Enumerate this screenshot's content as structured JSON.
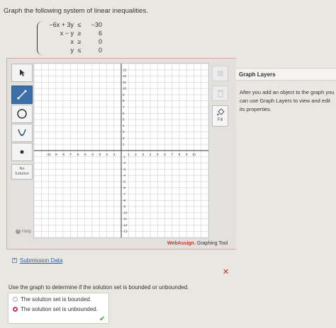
{
  "prompt": "Graph the following system of linear inequalities.",
  "system": [
    {
      "lhs": "−6x + 3y",
      "op": "≤",
      "rhs": "−30"
    },
    {
      "lhs": "x − y",
      "op": "≥",
      "rhs": "6"
    },
    {
      "lhs": "x",
      "op": "≥",
      "rhs": "0"
    },
    {
      "lhs": "y",
      "op": "≤",
      "rhs": "0"
    }
  ],
  "toolbar": {
    "tools": [
      "pointer-icon",
      "line-icon",
      "circle-icon",
      "parabola-icon",
      "point-icon"
    ],
    "active_tool": "line-icon",
    "no_solution_line1": "No",
    "no_solution_line2": "Solution",
    "help_label": "Help",
    "fill_label": "Fill"
  },
  "graph": {
    "x_ticks": [
      "-10",
      "-9",
      "-8",
      "-7",
      "-6",
      "-5",
      "-4",
      "-3",
      "-2",
      "-1",
      "1",
      "2",
      "3",
      "4",
      "5",
      "6",
      "7",
      "8",
      "9",
      "10"
    ],
    "y_ticks": [
      "13",
      "12",
      "11",
      "10",
      "9",
      "8",
      "7",
      "6",
      "5",
      "4",
      "3",
      "2",
      "1",
      "-1",
      "-2",
      "-3",
      "-4",
      "-5",
      "-6",
      "-7",
      "-8",
      "-9",
      "-10",
      "-11",
      "-12",
      "-13"
    ]
  },
  "brand": {
    "name": "WebAssign",
    "suffix": ". Graphing Tool"
  },
  "layers": {
    "title": "Graph Layers",
    "body": "After you add an object to the graph you can use Graph Layers to view and edit its properties."
  },
  "submission_label": "Submission Data",
  "question": "Use the graph to determine if the solution set is bounded or unbounded.",
  "options": [
    {
      "label": "The solution set is bounded.",
      "selected": false
    },
    {
      "label": "The solution set is unbounded.",
      "selected": true
    }
  ],
  "colors": {
    "accent": "#3c6fa7",
    "error": "#d02020",
    "correct": "#3aa03a",
    "selected_radio": "#c0396b"
  }
}
